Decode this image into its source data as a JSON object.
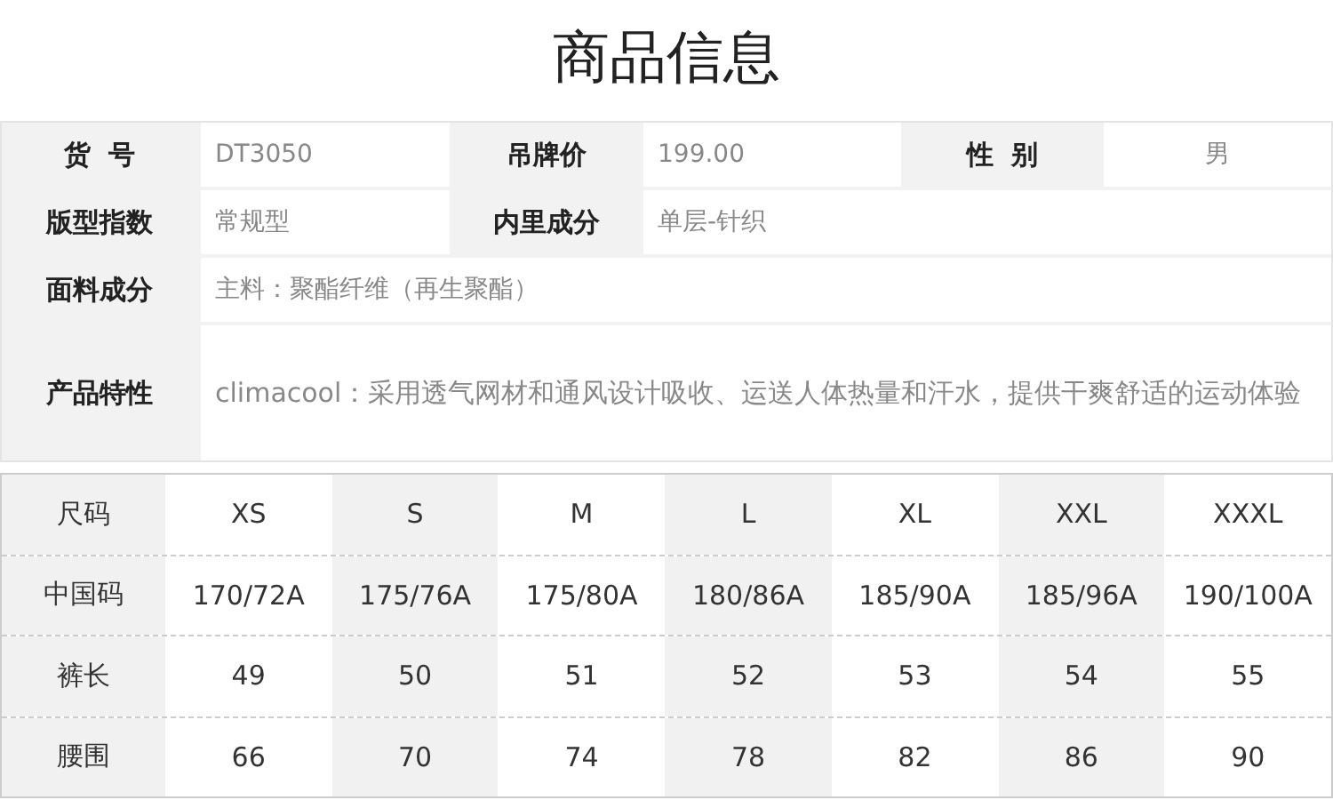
{
  "title": "商品信息",
  "specs": [
    [
      {
        "label": "货  号",
        "value": "DT3050"
      },
      {
        "label": "吊牌价",
        "value": "199.00"
      },
      {
        "label": "性  别",
        "value": "男"
      }
    ],
    [
      {
        "label": "版型指数",
        "value": "常规型"
      },
      {
        "label": "内里成分",
        "value": "单层-针织"
      }
    ],
    [
      {
        "label": "面料成分",
        "value": "主料：聚酯纤维（再生聚酯）"
      }
    ],
    [
      {
        "label": "产品特性",
        "value": "climacool：采用透气网材和通风设计吸收、运送人体热量和汗水，提供干爽舒适的运动体验"
      }
    ]
  ],
  "size_table": {
    "rows": [
      {
        "header": "尺码",
        "cells": [
          "XS",
          "S",
          "M",
          "L",
          "XL",
          "XXL",
          "XXXL"
        ]
      },
      {
        "header": "中国码",
        "cells": [
          "170/72A",
          "175/76A",
          "175/80A",
          "180/86A",
          "185/90A",
          "185/96A",
          "190/100A"
        ]
      },
      {
        "header": "裤长",
        "cells": [
          "49",
          "50",
          "51",
          "52",
          "53",
          "54",
          "55"
        ]
      },
      {
        "header": "腰围",
        "cells": [
          "66",
          "70",
          "74",
          "78",
          "82",
          "86",
          "90"
        ]
      }
    ]
  }
}
